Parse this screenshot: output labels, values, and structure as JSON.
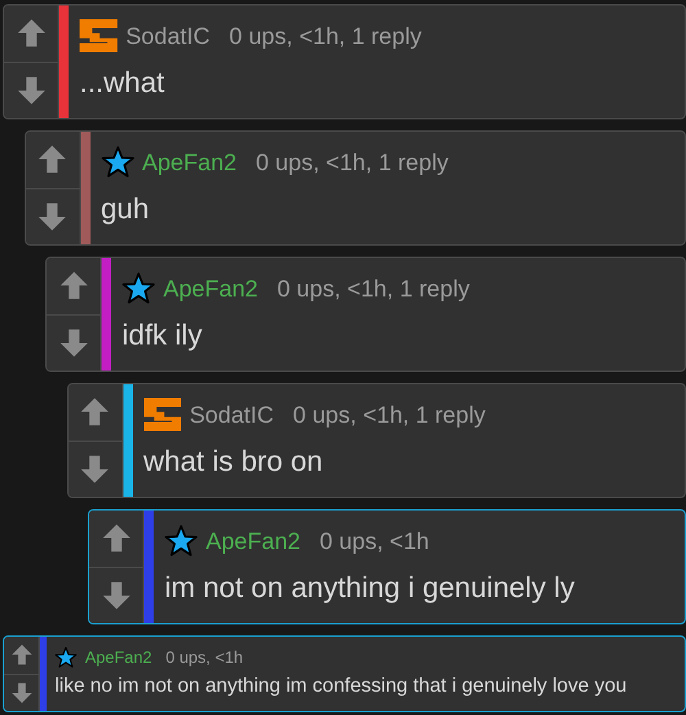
{
  "comments": [
    {
      "compact": false,
      "user": {
        "kind": "blocks",
        "name": "SodatIC",
        "color": "#9a9a9a"
      },
      "meta": "0 ups, <1h, 1 reply",
      "text": "...what",
      "color": "#e8333a",
      "highlighted": false
    },
    {
      "compact": false,
      "user": {
        "kind": "star",
        "name": "ApeFan2",
        "color": "#4caf50"
      },
      "meta": "0 ups, <1h, 1 reply",
      "text": "guh",
      "color": "#a05a5a",
      "highlighted": false
    },
    {
      "compact": false,
      "user": {
        "kind": "star",
        "name": "ApeFan2",
        "color": "#4caf50"
      },
      "meta": "0 ups, <1h, 1 reply",
      "text": "idfk ily",
      "color": "#c21ec4",
      "highlighted": false
    },
    {
      "compact": false,
      "user": {
        "kind": "blocks",
        "name": "SodatIC",
        "color": "#9a9a9a"
      },
      "meta": "0 ups, <1h, 1 reply",
      "text": "what is bro on",
      "color": "#1ab4e8",
      "highlighted": false
    },
    {
      "compact": false,
      "user": {
        "kind": "star",
        "name": "ApeFan2",
        "color": "#4caf50"
      },
      "meta": "0 ups, <1h",
      "text": "im not on anything i genuinely ly",
      "color": "#2f3fe8",
      "highlighted": true
    },
    {
      "compact": true,
      "user": {
        "kind": "star",
        "name": "ApeFan2",
        "color": "#4caf50"
      },
      "meta": "0 ups, <1h",
      "text": "like no im not on anything im confessing that i genuinely love you",
      "color": "#2f3fe8",
      "highlighted": true
    }
  ]
}
